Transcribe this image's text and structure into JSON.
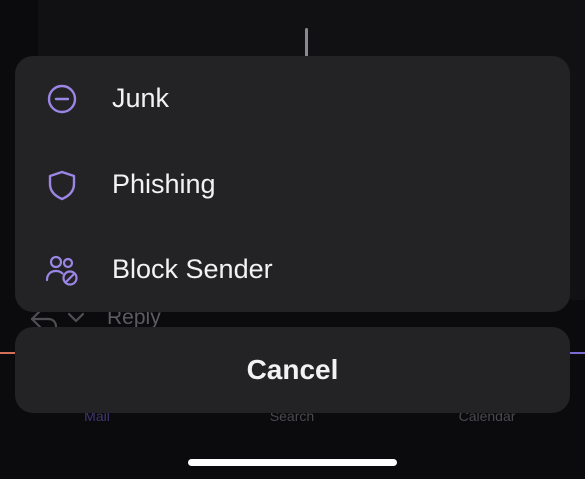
{
  "background": {
    "reply_label": "Reply",
    "tabs": [
      "Mail",
      "Search",
      "Calendar"
    ]
  },
  "sheet": {
    "items": [
      {
        "label": "Junk",
        "icon": "minus-circle-icon"
      },
      {
        "label": "Phishing",
        "icon": "shield-icon"
      },
      {
        "label": "Block Sender",
        "icon": "block-user-icon"
      }
    ],
    "cancel_label": "Cancel"
  },
  "colors": {
    "accent": "#9b86e6",
    "sheet_bg": "#232325",
    "text": "#f2f2f4"
  }
}
